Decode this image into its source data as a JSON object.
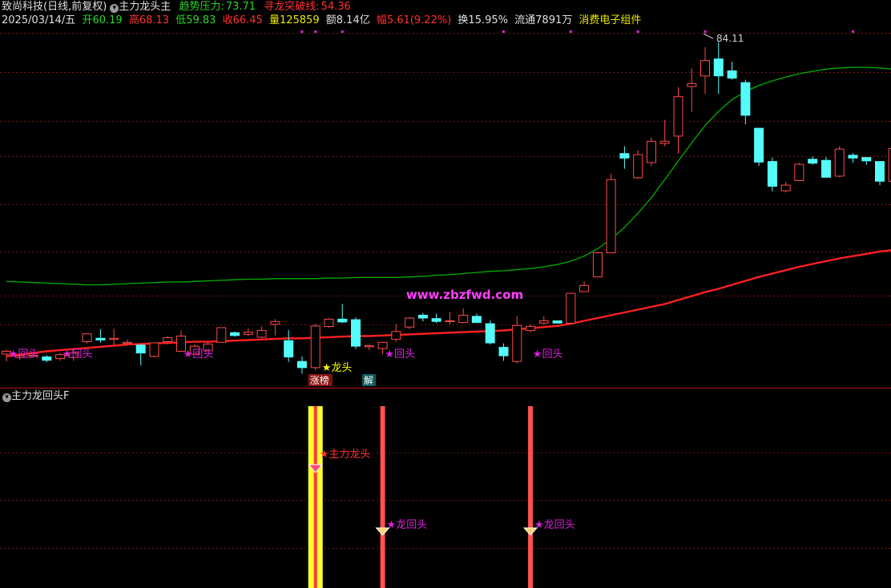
{
  "header": {
    "title": "致尚科技(日线,前复权)",
    "indicator_name": "主力龙头主",
    "trend_label": "趋势压力:",
    "trend_value": "73.71",
    "breakout_label": "寻龙突破线:",
    "breakout_value": "54.36",
    "date": "2025/03/14/五",
    "open_label": "开",
    "open": "60.19",
    "high_label": "高",
    "high": "68.13",
    "low_label": "低",
    "low": "59.83",
    "close_label": "收",
    "close": "66.45",
    "vol_label": "量",
    "vol": "125859",
    "amt_label": "额",
    "amt": "8.14亿",
    "chg_label": "幅",
    "chg": "5.61(9.22%)",
    "turnover_label": "换",
    "turnover": "15.95%",
    "float_label": "流通",
    "float": "7891万",
    "sector": "消费电子组件"
  },
  "sub_panel": {
    "title": "主力龙回头F"
  },
  "watermark": "www.zbzfwd.com",
  "colors": {
    "up": "#ff4a4a",
    "down": "#54fcfc",
    "ma_red": "#ff2020",
    "ma_green": "#00b000",
    "magenta": "#e020e0",
    "yellow": "#ffff00",
    "title_green": "#28d828"
  },
  "chart_data": {
    "type": "candlestick",
    "peak_label": "84.11",
    "candles": [
      [
        61.4,
        61.9,
        60.1,
        62.2
      ],
      [
        60.8,
        61.1,
        60.4,
        61.5
      ],
      [
        61.0,
        61.2,
        60.7,
        61.4
      ],
      [
        60.9,
        60.3,
        60.0,
        61.2
      ],
      [
        60.6,
        61.3,
        60.2,
        61.6
      ],
      [
        60.8,
        61.6,
        60.2,
        62.3
      ],
      [
        63.6,
        65.0,
        63.3,
        65.1
      ],
      [
        64.2,
        63.9,
        63.4,
        65.8
      ],
      [
        64.0,
        64.2,
        63.0,
        65.9
      ],
      [
        63.3,
        63.5,
        62.9,
        64.0
      ],
      [
        63.0,
        61.6,
        59.4,
        63.2
      ],
      [
        61.0,
        63.4,
        60.8,
        63.5
      ],
      [
        63.6,
        64.3,
        63.1,
        64.6
      ],
      [
        61.9,
        64.6,
        61.8,
        65.6
      ],
      [
        61.4,
        62.8,
        61.4,
        63.1
      ],
      [
        62.0,
        63.2,
        61.9,
        63.6
      ],
      [
        63.5,
        66.1,
        63.5,
        66.1
      ],
      [
        65.2,
        64.7,
        64.5,
        65.4
      ],
      [
        64.9,
        65.3,
        64.6,
        66.0
      ],
      [
        64.4,
        65.6,
        64.2,
        66.3
      ],
      [
        66.7,
        67.2,
        64.7,
        67.6
      ],
      [
        63.8,
        60.9,
        60.0,
        65.7
      ],
      [
        60.1,
        59.0,
        57.9,
        61.0
      ],
      [
        59.0,
        66.4,
        58.5,
        66.8
      ],
      [
        66.3,
        67.6,
        66.1,
        67.8
      ],
      [
        67.6,
        67.1,
        66.9,
        70.3
      ],
      [
        67.5,
        62.8,
        62.3,
        67.9
      ],
      [
        62.7,
        62.9,
        62.1,
        63.1
      ],
      [
        62.4,
        63.5,
        61.4,
        63.6
      ],
      [
        64.0,
        65.4,
        63.6,
        66.7
      ],
      [
        66.2,
        67.8,
        65.8,
        68.0
      ],
      [
        68.3,
        67.8,
        67.2,
        68.7
      ],
      [
        67.7,
        67.2,
        66.9,
        68.6
      ],
      [
        67.3,
        67.3,
        66.7,
        68.9
      ],
      [
        67.0,
        68.3,
        66.9,
        69.5
      ],
      [
        68.1,
        67.0,
        66.9,
        68.6
      ],
      [
        66.8,
        63.4,
        63.1,
        67.4
      ],
      [
        62.6,
        61.1,
        60.2,
        63.3
      ],
      [
        60.1,
        66.5,
        59.8,
        68.1
      ],
      [
        65.6,
        66.3,
        65.3,
        66.7
      ],
      [
        66.9,
        67.3,
        66.6,
        68.1
      ],
      [
        67.3,
        66.9,
        66.9,
        67.3
      ],
      [
        66.9,
        72.2,
        66.9,
        72.3
      ],
      [
        72.5,
        73.6,
        72.5,
        74.3
      ],
      [
        75.1,
        79.4,
        75.1,
        79.4
      ],
      [
        79.4,
        92.4,
        79.4,
        93.4
      ],
      [
        97.0,
        96.2,
        94.3,
        98.3
      ],
      [
        92.7,
        96.8,
        92.5,
        97.6
      ],
      [
        95.4,
        99.2,
        94.8,
        99.9
      ],
      [
        98.8,
        99.2,
        98.3,
        103.0
      ],
      [
        100.1,
        107.1,
        97.0,
        108.8
      ],
      [
        108.9,
        109.4,
        104.4,
        112.1
      ],
      [
        110.8,
        113.5,
        107.6,
        115.9
      ],
      [
        113.8,
        110.8,
        107.6,
        116.8
      ],
      [
        111.7,
        110.4,
        110.1,
        113.3
      ],
      [
        109.6,
        103.8,
        102.2,
        110.1
      ],
      [
        101.5,
        95.5,
        94.8,
        101.6
      ],
      [
        95.6,
        91.2,
        90.3,
        96.3
      ],
      [
        90.4,
        91.4,
        90.1,
        92.0
      ],
      [
        92.2,
        95.1,
        92.2,
        95.4
      ],
      [
        96.0,
        95.3,
        95.0,
        96.5
      ],
      [
        95.8,
        92.8,
        92.8,
        96.4
      ],
      [
        93.0,
        97.8,
        92.8,
        98.3
      ],
      [
        96.7,
        96.2,
        95.4,
        97.1
      ],
      [
        96.3,
        95.7,
        95.0,
        96.2
      ],
      [
        95.6,
        92.1,
        91.4,
        95.6
      ],
      [
        92.1,
        97.9,
        91.6,
        98.4
      ]
    ],
    "ma_red": [
      61.0,
      61.3,
      61.6,
      61.9,
      62.1,
      62.3,
      62.5,
      62.7,
      62.9,
      63.1,
      63.2,
      63.3,
      63.4,
      63.5,
      63.6,
      63.6,
      63.7,
      63.8,
      63.9,
      64.0,
      64.1,
      64.2,
      64.2,
      64.3,
      64.4,
      64.5,
      64.6,
      64.6,
      64.7,
      64.8,
      64.9,
      65.0,
      65.1,
      65.2,
      65.3,
      65.4,
      65.5,
      65.6,
      65.8,
      66.0,
      66.2,
      66.4,
      66.8,
      67.3,
      67.8,
      68.3,
      68.8,
      69.3,
      69.8,
      70.3,
      71.0,
      71.7,
      72.4,
      73.0,
      73.7,
      74.4,
      75.1,
      75.7,
      76.3,
      76.9,
      77.4,
      77.9,
      78.4,
      78.8,
      79.2,
      79.6,
      79.9
    ],
    "ma_green": [
      74.3,
      74.2,
      74.1,
      74.0,
      73.9,
      73.8,
      73.7,
      73.7,
      73.8,
      73.9,
      74.0,
      74.1,
      74.2,
      74.2,
      74.3,
      74.4,
      74.5,
      74.6,
      74.7,
      74.7,
      74.8,
      74.8,
      74.8,
      74.8,
      74.9,
      74.9,
      75.0,
      75.0,
      75.0,
      75.0,
      75.1,
      75.2,
      75.4,
      75.5,
      75.7,
      75.9,
      76.1,
      76.2,
      76.4,
      76.6,
      76.9,
      77.3,
      77.9,
      78.8,
      80.1,
      81.8,
      83.9,
      86.4,
      89.2,
      92.4,
      95.7,
      98.9,
      102.0,
      104.5,
      106.6,
      108.0,
      109.1,
      109.9,
      110.6,
      111.2,
      111.6,
      112.0,
      112.2,
      112.3,
      112.3,
      112.2,
      112.0
    ],
    "price_range": [
      56,
      120
    ],
    "gridline_prices": [
      66.6,
      71.8,
      79.6,
      88.0,
      96.5,
      102.8,
      111.4,
      118.4
    ],
    "signals": [
      {
        "index": 1,
        "label": "★回头"
      },
      {
        "index": 5,
        "label": "★回头"
      },
      {
        "index": 14,
        "label": "★回头"
      },
      {
        "index": 29,
        "label": "★回头"
      },
      {
        "index": 40,
        "label": "★回头"
      }
    ],
    "dragon_head": {
      "index": 23,
      "label": "★龙头"
    },
    "tags": [
      {
        "index": 23,
        "label": "涨榜"
      },
      {
        "index": 26,
        "label": "解"
      }
    ],
    "marker_indices": [
      22,
      23,
      25,
      37,
      42,
      47,
      52,
      63
    ],
    "sub_bars": [
      {
        "index": 23,
        "kind": "yellow",
        "label": "★主力龙头"
      },
      {
        "index": 28,
        "kind": "red",
        "label": "★龙回头"
      },
      {
        "index": 39,
        "kind": "red",
        "label": "★龙回头"
      }
    ]
  }
}
